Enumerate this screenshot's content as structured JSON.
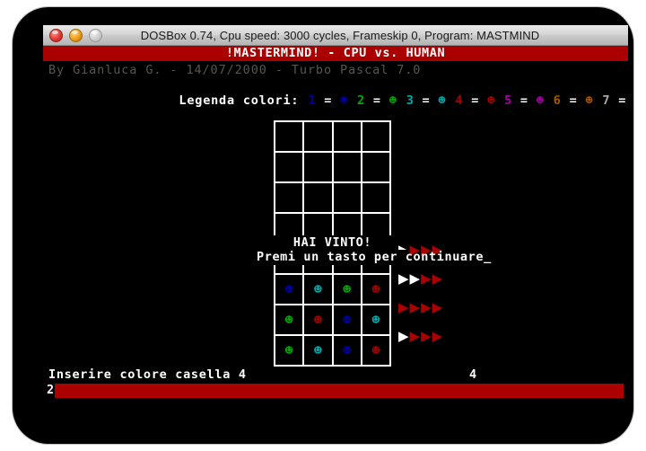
{
  "window": {
    "title": "DOSBox 0.74, Cpu speed:    3000 cycles, Frameskip  0, Program: MASTMIND",
    "controls": {
      "close": "close-button",
      "minimize": "minimize-button",
      "zoom": "zoom-button"
    }
  },
  "dos": {
    "banner": "!MASTERMIND! - CPU vs. HUMAN",
    "byline": "By Gianluca G. - 14/07/2000 - Turbo Pascal 7.0",
    "legend": {
      "label": "Legenda colori:",
      "glyph": "☻",
      "eq": "=",
      "entries": [
        {
          "num": "1",
          "color": "#0000aa"
        },
        {
          "num": "2",
          "color": "#00aa00"
        },
        {
          "num": "3",
          "color": "#00aaaa"
        },
        {
          "num": "4",
          "color": "#aa0000"
        },
        {
          "num": "5",
          "color": "#aa00aa"
        },
        {
          "num": "6",
          "color": "#aa5500"
        },
        {
          "num": "7",
          "color": "#aaaaaa"
        }
      ]
    },
    "board": {
      "columns": 4,
      "empty_rows": 4,
      "rows": [
        {
          "pegs": [
            null,
            null,
            null,
            null
          ],
          "feedback": []
        },
        {
          "pegs": [
            null,
            null,
            null,
            null
          ],
          "feedback": []
        },
        {
          "pegs": [
            null,
            null,
            null,
            null
          ],
          "feedback": []
        },
        {
          "pegs": [
            null,
            null,
            null,
            null
          ],
          "feedback": []
        },
        {
          "pegs": [
            "#0000aa",
            "#00aaaa",
            "#aa0000",
            "#00aa00"
          ],
          "feedback": [
            "white",
            "red",
            "red",
            "red"
          ]
        },
        {
          "pegs": [
            "#0000aa",
            "#00aaaa",
            "#00aa00",
            "#aa0000"
          ],
          "feedback": [
            "white",
            "white",
            "red",
            "red"
          ]
        },
        {
          "pegs": [
            "#00aa00",
            "#aa0000",
            "#0000aa",
            "#00aaaa"
          ],
          "feedback": [
            "red",
            "red",
            "red",
            "red"
          ]
        },
        {
          "pegs": [
            "#00aa00",
            "#00aaaa",
            "#0000aa",
            "#aa0000"
          ],
          "feedback": [
            "white",
            "red",
            "red",
            "red"
          ]
        }
      ],
      "peg_glyph": "☻",
      "arrow_glyph": "▶"
    },
    "overlay": {
      "win_message": "HAI VINTO!",
      "continue_message": "Premi un tasto per continuare_"
    },
    "prompt": {
      "text": "Inserire colore casella 4",
      "count": "4",
      "input_value": "2"
    }
  },
  "colors": {
    "banner_bg": "#aa0000",
    "input_bar": "#aa0000",
    "screen_bg": "#000000",
    "grid_line": "#ffffff",
    "text": "#ffffff",
    "byline": "#555555"
  }
}
